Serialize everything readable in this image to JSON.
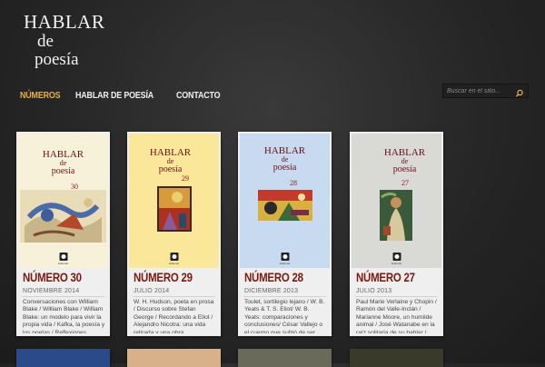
{
  "site": {
    "logo": [
      "HABLAR",
      "de",
      "poesía"
    ]
  },
  "nav": {
    "items": [
      "NÚMEROS",
      "HABLAR DE POESÍA",
      "CONTACTO"
    ],
    "active": 0
  },
  "search": {
    "placeholder": "Buscar en el sitio..."
  },
  "cover": {
    "l1": "HABLAR",
    "l2": "de",
    "l3": "poesía",
    "publisher": "Editorial"
  },
  "cards": [
    {
      "title": "NÚMERO 30",
      "date": "NOVIEMBRE 2014",
      "cover_num": "30",
      "cover_bg": "#f7f1da",
      "desc": "Conversaciones con William Blake / William Blake / William Blake: un modelo para vivir la propia vida / Kafka, la poesía y los poetas  / Reflexiones"
    },
    {
      "title": "NÚMERO 29",
      "date": "JULIO 2014",
      "cover_num": "29",
      "cover_bg": "#fbe79a",
      "desc": "W. H. Hudson, poeta en prosa / Discurso sobre Stefan George / Recordando a Eliot / Alejandro Nicotra: una vida retirada y una obra"
    },
    {
      "title": "NÚMERO 28",
      "date": "DICIEMBRE 2013",
      "cover_num": "28",
      "cover_bg": "#c7daef",
      "desc": "Toulet, sortilegio lejano / W. B. Yeats & T. S. Eliot/ W. B. Yeats: comparaciones y conclusiones/ César Vallejo o el cuerpo que sufrió de ser"
    },
    {
      "title": "NÚMERO 27",
      "date": "JULIO 2013",
      "cover_num": "27",
      "cover_bg": "#d9d9d6",
      "desc": "Paul Marie Verlaine y Chopin / Ramón del Valle-Inclán / Marianne Moore, un humilde animal / José Watanabe en la raíz solitaria de su hablar /"
    }
  ]
}
